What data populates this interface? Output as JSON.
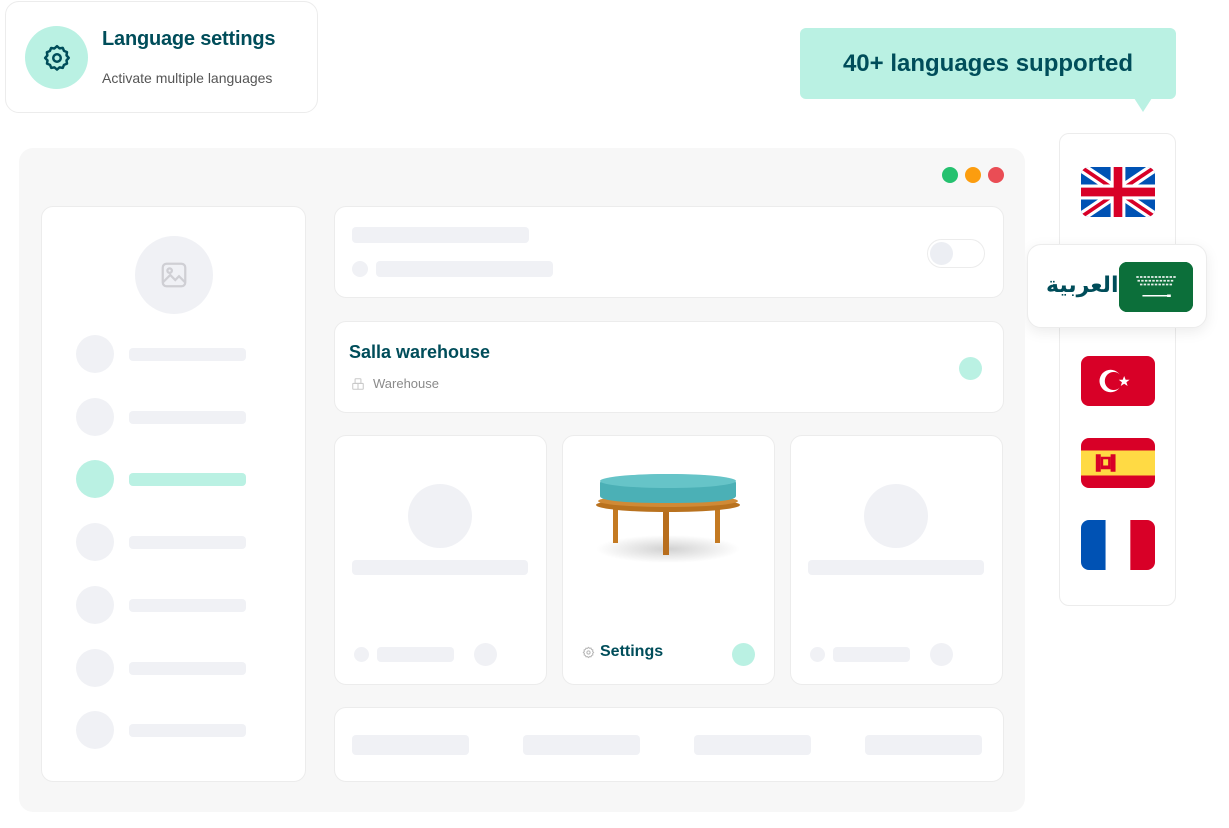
{
  "feature_card": {
    "icon": "gear-icon",
    "title": "Language settings",
    "subtitle": "Activate multiple languages"
  },
  "callout": {
    "text": "40+ languages supported"
  },
  "languages": {
    "items": [
      {
        "name": "English",
        "flag": "uk-flag"
      },
      {
        "name": "Arabic",
        "flag": "saudi-flag",
        "label": "العربية",
        "selected": true
      },
      {
        "name": "Turkish",
        "flag": "turkey-flag"
      },
      {
        "name": "Spanish",
        "flag": "spain-flag"
      },
      {
        "name": "French",
        "flag": "france-flag"
      }
    ]
  },
  "window": {
    "controls": [
      "green",
      "orange",
      "red"
    ],
    "sidebar": {
      "avatar_icon": "image-icon",
      "items_count": 7,
      "active_index": 2
    },
    "warehouse": {
      "name": "Salla warehouse",
      "type": "Warehouse",
      "type_icon": "warehouse-icon"
    },
    "product_card": {
      "image": "ottoman-stool",
      "label": "Settings",
      "label_icon": "gear-icon"
    }
  },
  "colors": {
    "brand_dark": "#004d5a",
    "mint": "#baf1e3",
    "placeholder": "#f0f1f5",
    "window_bg": "#f7f7f7"
  }
}
